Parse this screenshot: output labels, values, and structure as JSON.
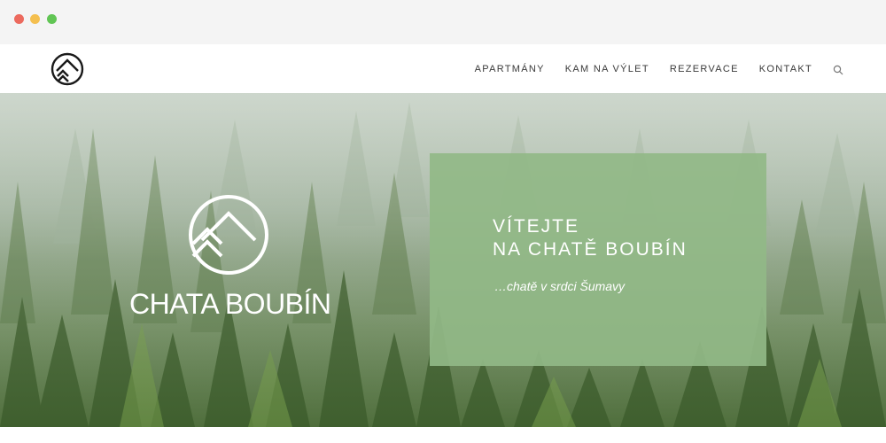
{
  "window": {
    "controls": [
      "close",
      "minimize",
      "maximize"
    ]
  },
  "header": {
    "logo_icon": "chata-boubin-logo-icon",
    "nav": [
      {
        "label": "APARTMÁNY"
      },
      {
        "label": "KAM NA VÝLET"
      },
      {
        "label": "REZERVACE"
      },
      {
        "label": "KONTAKT"
      }
    ],
    "search_icon": "search-icon"
  },
  "hero": {
    "brand_name": "CHATA BOUBÍN",
    "welcome_line_1": "VÍTEJTE",
    "welcome_line_2": "NA CHATĚ BOUBÍN",
    "tagline": "…chatě v srdci Šumavy",
    "box_color": "#91b987",
    "background": "misty-forest-photo"
  }
}
